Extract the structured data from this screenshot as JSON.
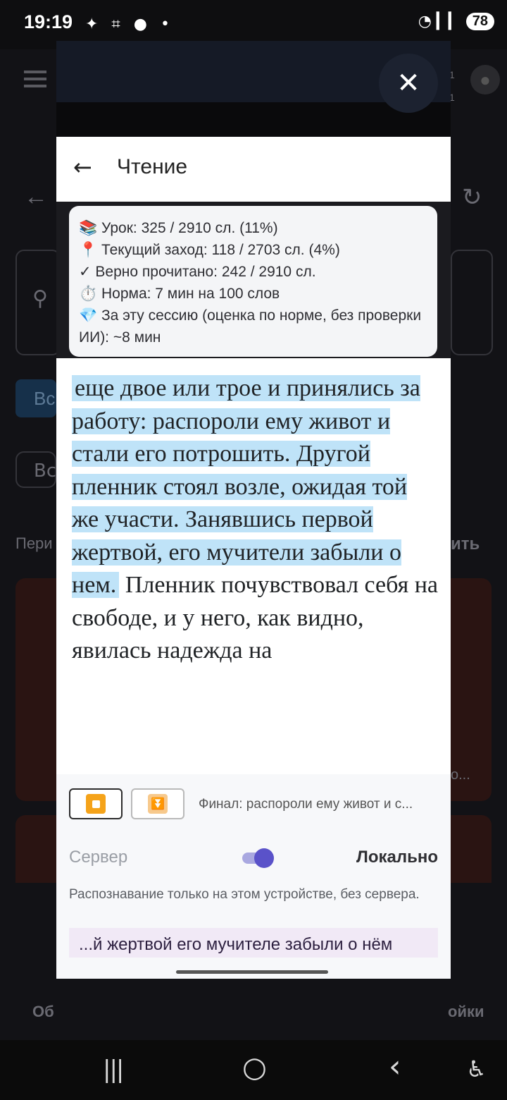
{
  "status_bar": {
    "time": "19:19",
    "left_icons": " ✦ ⌗ ● •",
    "wifi_signal": "◔ ▎▎",
    "battery": "78"
  },
  "background_app": {
    "side_label_left": "Пери",
    "side_label_right": "ить",
    "chip_label": "Вс",
    "chip_label_2": "Вс",
    "letter_1": "1",
    "letter_2": "1",
    "bottom_left": "Об",
    "bottom_right": "ойки",
    "ellipsis": "о..."
  },
  "modal": {
    "close_label": "✕",
    "header": {
      "back_label": "←",
      "title": "Чтение"
    },
    "stats": [
      "📚 Урок: 325 / 2910 сл. (11%)",
      "📍 Текущий заход: 118 / 2703 сл. (4%)",
      "✓ Верно прочитано: 242 / 2910 сл.",
      "⏱️ Норма: 7 мин на 100 слов",
      "💎 За эту сессию (оценка по норме, без проверки ИИ): ~8 мин"
    ],
    "reading_highlighted": "еще двое или трое и принялись за работу: распороли ему живот и стали его потрошить. Другой пленник стоял возле, ожидая той же участи. Занявшись первой жертвой, его мучители забыли о нем.",
    "reading_plain": "Пленник почувствовал себя на свободе, и у него, как видно, явилась надежда на",
    "controls": {
      "stop_label": "■",
      "download_label": "⏬",
      "final_text": "Финал: распороли ему живот и с..."
    },
    "mode": {
      "server_label": "Сервер",
      "local_label": "Локально",
      "local_enabled": true,
      "note": "Распознавание только на этом устройстве, без сервера."
    },
    "transcript": "...й жертвой его мучителе забыли о нём"
  },
  "nav_bar": {
    "recents": "|||",
    "home": "○",
    "back": "‹",
    "accessibility": "♿"
  },
  "colors": {
    "highlight": "#bfe3f8",
    "toggle_accent": "#5a52c9",
    "stop_orange": "#f5a31a"
  }
}
